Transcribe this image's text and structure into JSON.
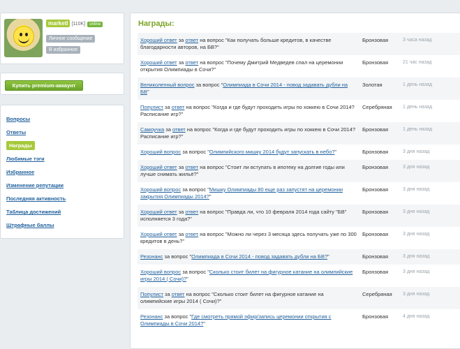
{
  "profile": {
    "username": "marketl",
    "karma": "[110K]",
    "online": "online",
    "message_btn": "Личное сообщение",
    "favorite_btn": "В избранное"
  },
  "premium": {
    "label": "Купить premium-аккаунт"
  },
  "menu": {
    "items": [
      {
        "label": "Вопросы"
      },
      {
        "label": "Ответы"
      },
      {
        "label": "Награды",
        "active": true
      },
      {
        "label": "Любимые тэги"
      },
      {
        "label": "Избранное"
      },
      {
        "label": "Изменение репутации"
      },
      {
        "label": "Последняя активность"
      },
      {
        "label": "Таблица достижений"
      },
      {
        "label": "Штрафные баллы"
      }
    ]
  },
  "main": {
    "title": "Награды:",
    "awards": [
      {
        "award": "Хороший ответ",
        "mid": " за ",
        "link": "ответ",
        "after": " на вопрос \"Как получать больше кредитов, в качестве благодарности авторов, на БВ?\"",
        "level": "Бронзовая",
        "time": "3 часа назад"
      },
      {
        "award": "Хороший ответ",
        "mid": " за ",
        "link": "ответ",
        "after": " на вопрос \"Почему Дмитрий Медведев спал на церемонии открытия Олимпиады в Сочи?\"",
        "level": "Бронзовая",
        "time": "21 час назад"
      },
      {
        "award": "Великолепный вопрос",
        "mid": " за вопрос \"",
        "link": "Олимпиада в Сочи 2014 - повод задавать дубли на БВ",
        "after": "\"",
        "level": "Золотая",
        "time": "1 день назад"
      },
      {
        "award": "Популист",
        "mid": " за ",
        "link": "ответ",
        "after": " на вопрос \"Когда и где будут проходить игры по хоккею в Сочи 2014? Расписание игр?\"",
        "level": "Серебряная",
        "time": "1 день назад"
      },
      {
        "award": "Самоучка",
        "mid": " за ",
        "link": "ответ",
        "after": " на вопрос \"Когда и где будут проходить игры по хоккею в Сочи 2014? Расписание игр?\"",
        "level": "Бронзовая",
        "time": "1 день назад"
      },
      {
        "award": "Хороший вопрос",
        "mid": " за вопрос \"",
        "link": "Олимпийского мишку 2014 будут запускать в небо?",
        "after": "\"",
        "level": "Бронзовая",
        "time": "3 дня назад"
      },
      {
        "award": "Хороший ответ",
        "mid": " за ",
        "link": "ответ",
        "after": " на вопрос \"Стоит ли вступать в ипотеку на долгие годы или лучше снимать жильё?\"",
        "level": "Бронзовая",
        "time": "3 дня назад"
      },
      {
        "award": "Хороший вопрос",
        "mid": " за вопрос \"",
        "link": "Мишку Олимпиады 80 еще раз запустят на церемонии закрытия Олимпиады 2014?",
        "after": "\"",
        "level": "Бронзовая",
        "time": "3 дня назад"
      },
      {
        "award": "Хороший ответ",
        "mid": " за ",
        "link": "ответ",
        "after": " на вопрос \"Правда ли, что 10 февраля 2014 года сайту \"БВ\" исполняется 3 года?\"",
        "level": "Бронзовая",
        "time": "3 дня назад"
      },
      {
        "award": "Хороший ответ",
        "mid": " за ",
        "link": "ответ",
        "after": " на вопрос \"Можно ли через 3 месяца здесь получать уже по 300 кредитов в день?\"",
        "level": "Бронзовая",
        "time": "3 дня назад"
      },
      {
        "award": "Резонанс",
        "mid": " за вопрос \"",
        "link": "Олимпиада в Сочи 2014 - повод задавать дубли на БВ?",
        "after": "\"",
        "level": "Бронзовая",
        "time": "3 дня назад"
      },
      {
        "award": "Хороший вопрос",
        "mid": " за вопрос \"",
        "link": "Сколько стоит билет на фигурное катание на олимпийские игры 2014 ( Сочи)?",
        "after": "\"",
        "level": "Бронзовая",
        "time": "3 дня назад"
      },
      {
        "award": "Популист",
        "mid": " за ",
        "link": "ответ",
        "after": " на вопрос \"Сколько стоит билет на фигурное катание на олимпийские игры 2014 ( Сочи)?\"",
        "level": "Серебряная",
        "time": "3 дня назад"
      },
      {
        "award": "Резонанс",
        "mid": " за вопрос \"",
        "link": "Где смотреть прямой эфир/запись церемонии открытия с Олимпиады в Сочи 2014?",
        "after": "\"",
        "level": "Бронзовая",
        "time": "4 дня назад"
      }
    ]
  }
}
